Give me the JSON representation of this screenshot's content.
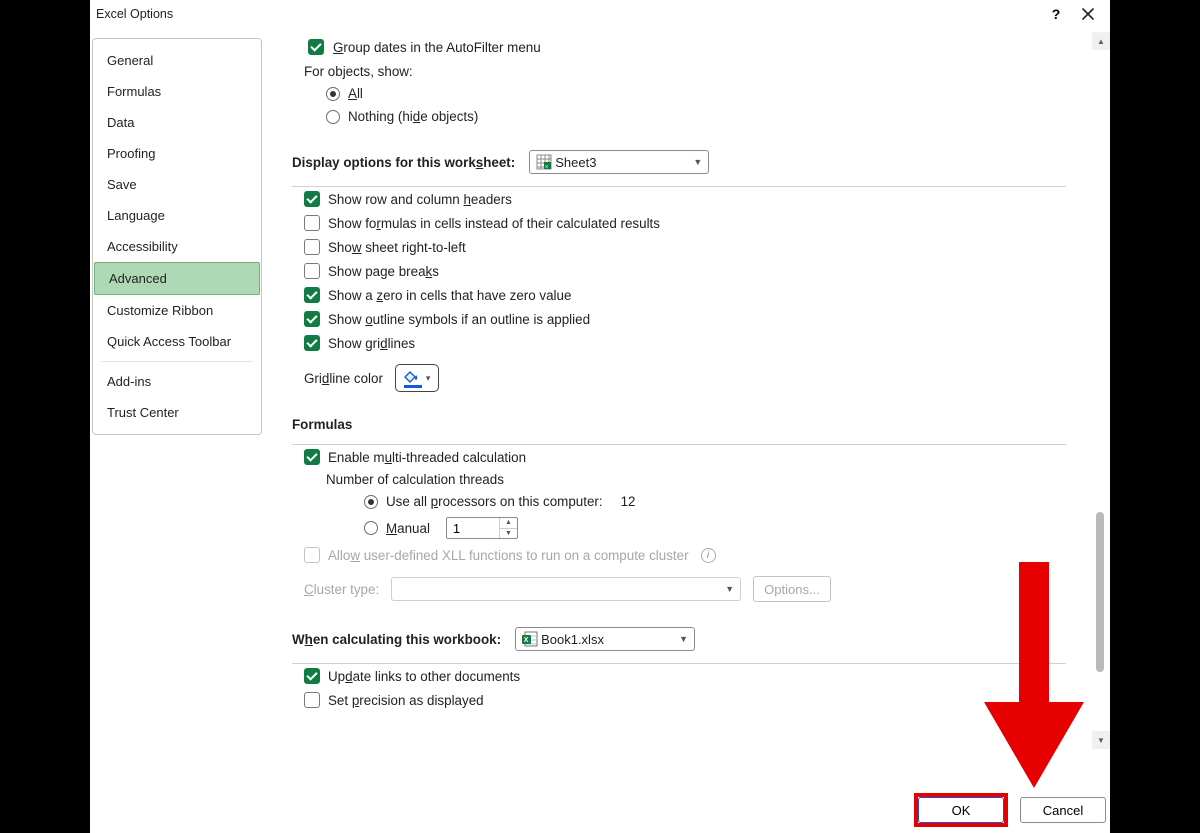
{
  "title": "Excel Options",
  "sidebar": {
    "items": [
      "General",
      "Formulas",
      "Data",
      "Proofing",
      "Save",
      "Language",
      "Accessibility",
      "Advanced",
      "Customize Ribbon",
      "Quick Access Toolbar",
      "Add-ins",
      "Trust Center"
    ],
    "selected": 7
  },
  "autofilter": {
    "group_dates": "Group dates in the AutoFilter menu"
  },
  "objects": {
    "label": "For objects, show:",
    "all": "All",
    "nothing": "Nothing (hide objects)"
  },
  "worksheet": {
    "heading": "Display options for this worksheet:",
    "selected": "Sheet3",
    "row_col_headers": "Show row and column headers",
    "show_formulas": "Show formulas in cells instead of their calculated results",
    "rtl": "Show sheet right-to-left",
    "page_breaks": "Show page breaks",
    "zeros": "Show a zero in cells that have zero value",
    "outline": "Show outline symbols if an outline is applied",
    "gridlines": "Show gridlines",
    "gridline_color": "Gridline color"
  },
  "formulas": {
    "heading": "Formulas",
    "multi": "Enable multi-threaded calculation",
    "threads": "Number of calculation threads",
    "all_processors": "Use all processors on this computer:",
    "processors_count": "12",
    "manual": "Manual",
    "manual_value": "1",
    "xll": "Allow user-defined XLL functions to run on a compute cluster",
    "cluster": "Cluster type:",
    "options_btn": "Options..."
  },
  "workbook": {
    "heading": "When calculating this workbook:",
    "selected": "Book1.xlsx",
    "update_links": "Update links to other documents",
    "precision": "Set precision as displayed"
  },
  "buttons": {
    "ok": "OK",
    "cancel": "Cancel"
  }
}
